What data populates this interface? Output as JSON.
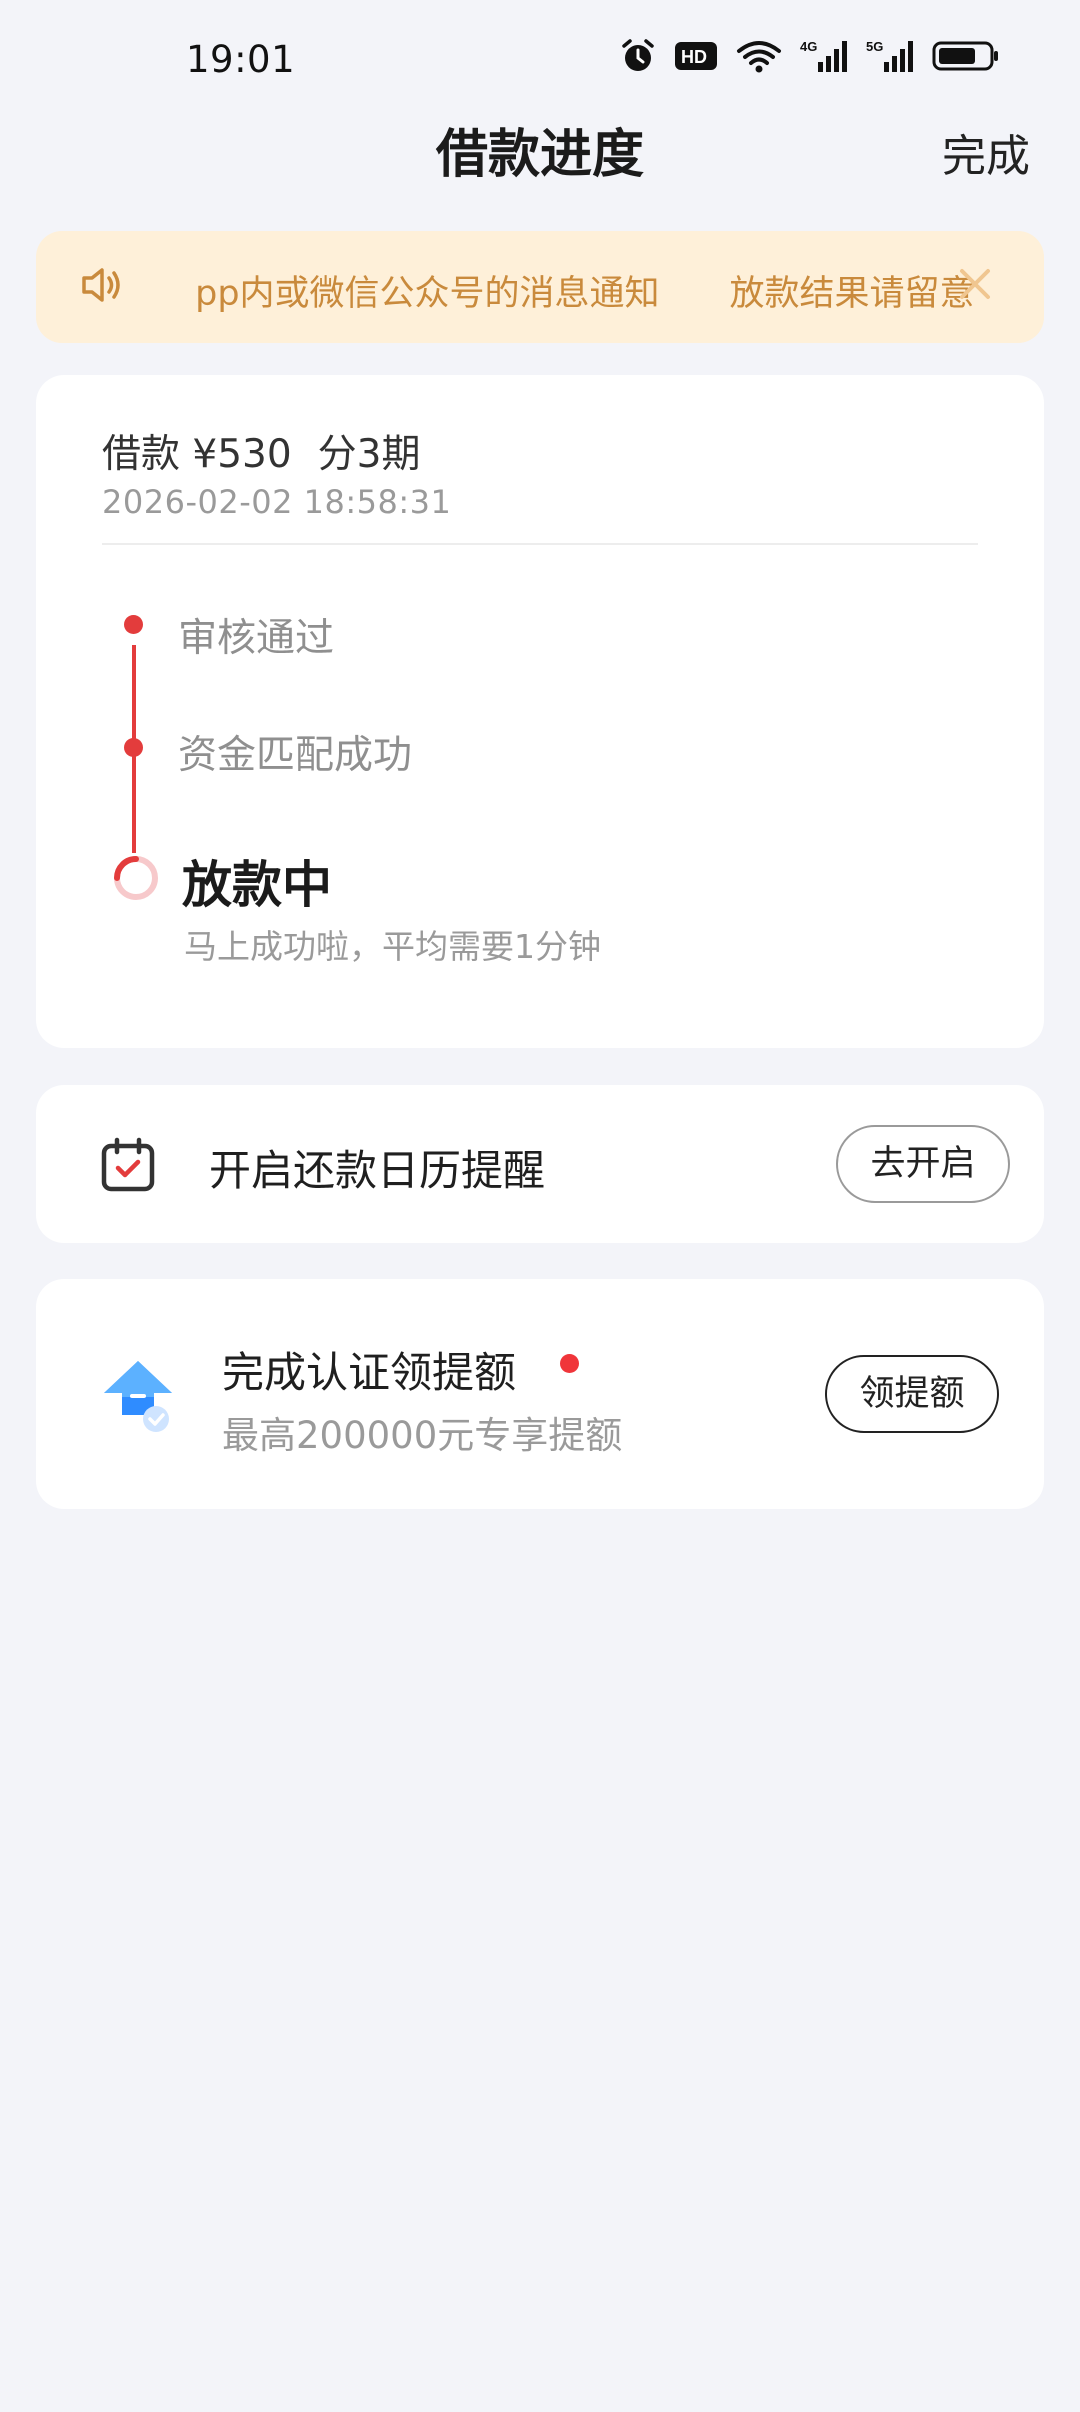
{
  "status_bar": {
    "time": "19:01",
    "icons": [
      "alarm-icon",
      "hd-icon",
      "wifi-icon",
      "signal-4g-icon",
      "signal-5g-icon",
      "battery-icon"
    ],
    "hd_label": "HD",
    "net1_label": "4G",
    "net2_label": "5G",
    "battery_level": 0.75
  },
  "header": {
    "title": "借款进度",
    "done_label": "完成"
  },
  "notice": {
    "text": " pp内或微信公众号的消息通知　　放款结果请留意",
    "icon": "speaker-icon",
    "close_icon": "close-icon"
  },
  "loan": {
    "amount_label": "借款 ¥530",
    "installment_label": "分3期",
    "datetime": "2026-02-02 18:58:31",
    "steps": [
      {
        "label": "审核通过",
        "state": "done"
      },
      {
        "label": "资金匹配成功",
        "state": "done"
      },
      {
        "label": "放款中",
        "state": "current",
        "desc": "马上成功啦，平均需要1分钟"
      }
    ]
  },
  "calendar_reminder": {
    "title": "开启还款日历提醒",
    "button_label": "去开启",
    "icon": "calendar-check-icon"
  },
  "credit_boost": {
    "title": "完成认证领提额",
    "subtitle": "最高200000元专享提额",
    "button_label": "领提额",
    "icon": "arrow-up-badge-icon"
  },
  "colors": {
    "accent_red": "#e33c3c",
    "notice_bg": "#fef0d9",
    "notice_text": "#c98a3c",
    "page_bg": "#f3f4f9"
  }
}
